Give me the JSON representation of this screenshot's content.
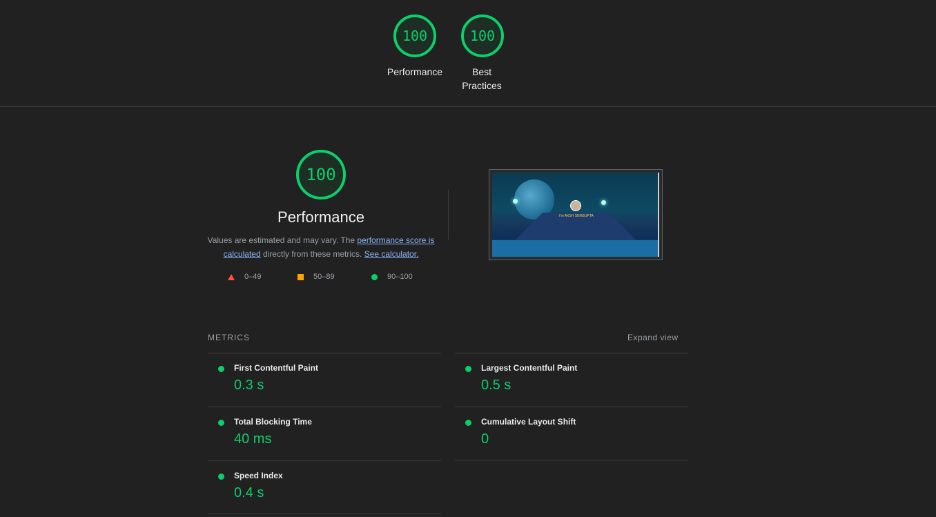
{
  "summary_gauges": [
    {
      "score": "100",
      "label": "Performance"
    },
    {
      "score": "100",
      "label_line1": "Best",
      "label_line2": "Practices"
    }
  ],
  "performance": {
    "score": "100",
    "title": "Performance",
    "desc_part1": "Values are estimated and may vary. The ",
    "link_score": "performance score is calculated",
    "desc_part2": " directly from these metrics. ",
    "link_calculator": "See calculator."
  },
  "legend": [
    {
      "range": "0–49",
      "color": "#ff4e42",
      "shape": "triangle"
    },
    {
      "range": "50–89",
      "color": "#ffa400",
      "shape": "square"
    },
    {
      "range": "90–100",
      "color": "#0cce6b",
      "shape": "circle"
    }
  ],
  "screenshot": {
    "caption": "I'm AKSH SENGUPTA"
  },
  "metrics": {
    "heading": "METRICS",
    "expand_label": "Expand view",
    "items": [
      {
        "name": "First Contentful Paint",
        "value": "0.3 s"
      },
      {
        "name": "Largest Contentful Paint",
        "value": "0.5 s"
      },
      {
        "name": "Total Blocking Time",
        "value": "40 ms"
      },
      {
        "name": "Cumulative Layout Shift",
        "value": "0"
      },
      {
        "name": "Speed Index",
        "value": "0.4 s"
      }
    ]
  },
  "colors": {
    "pass": "#0cce6b",
    "background": "#212121",
    "link": "#8ab4f8"
  }
}
